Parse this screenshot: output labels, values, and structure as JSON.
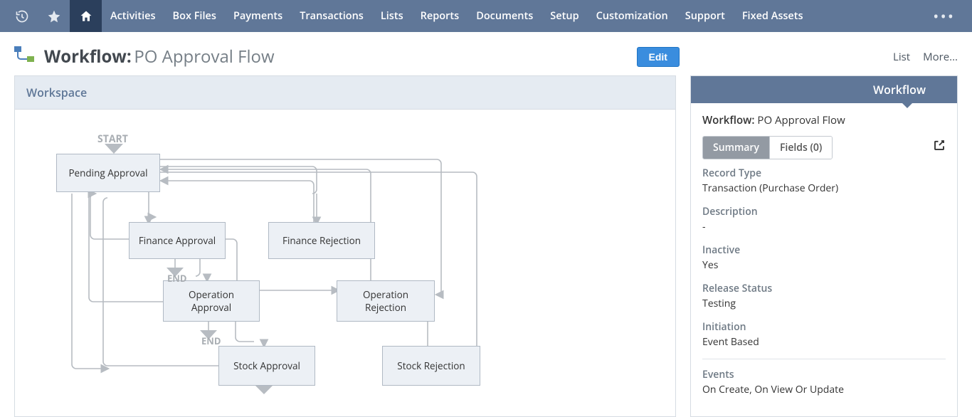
{
  "nav": {
    "items": [
      "Activities",
      "Box Files",
      "Payments",
      "Transactions",
      "Lists",
      "Reports",
      "Documents",
      "Setup",
      "Customization",
      "Support",
      "Fixed Assets"
    ]
  },
  "page": {
    "title_prefix": "Workflow:",
    "title_name": "PO Approval Flow",
    "edit_label": "Edit",
    "list_label": "List",
    "more_label": "More..."
  },
  "workspace": {
    "header": "Workspace",
    "start_label": "START",
    "end_label": "END",
    "states": {
      "pending": "Pending Approval",
      "fin_appr": "Finance Approval",
      "fin_rej": "Finance Rejection",
      "op_appr": "Operation Approval",
      "op_rej": "Operation Rejection",
      "stock_appr": "Stock Approval",
      "stock_rej": "Stock Rejection"
    }
  },
  "sidebar": {
    "header": "Workflow",
    "title_prefix": "Workflow:",
    "title_name": "PO Approval Flow",
    "tabs": {
      "summary": "Summary",
      "fields": "Fields (0)"
    },
    "fields": {
      "record_type": {
        "label": "Record Type",
        "value": "Transaction (Purchase Order)"
      },
      "description": {
        "label": "Description",
        "value": "-"
      },
      "inactive": {
        "label": "Inactive",
        "value": "Yes"
      },
      "release_status": {
        "label": "Release Status",
        "value": "Testing"
      },
      "initiation": {
        "label": "Initiation",
        "value": "Event Based"
      },
      "events": {
        "label": "Events",
        "value": "On Create, On View Or Update"
      }
    }
  }
}
